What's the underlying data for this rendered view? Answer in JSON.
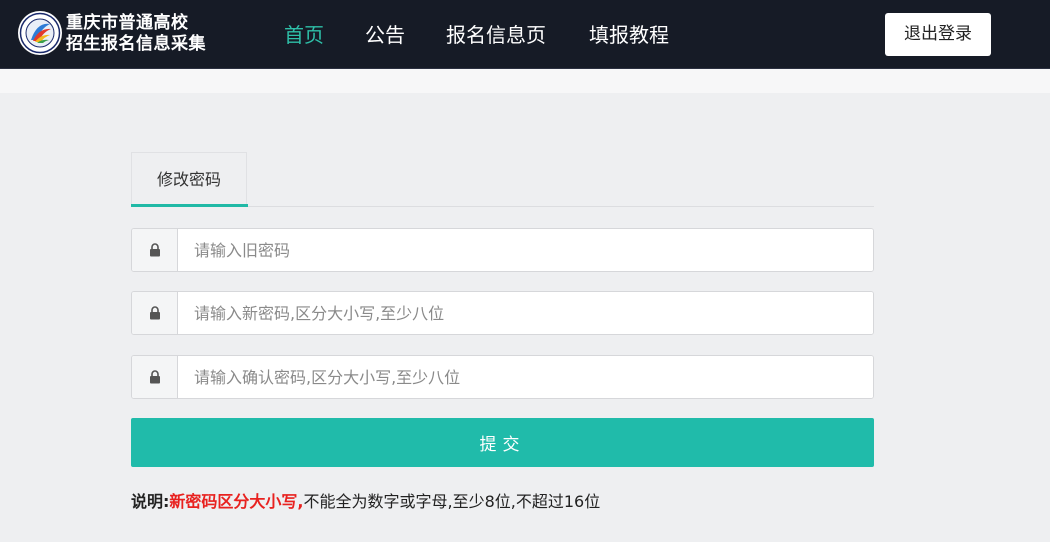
{
  "header": {
    "brand_line1": "重庆市普通高校",
    "brand_line2": "招生报名信息采集",
    "nav": [
      {
        "label": "首页",
        "active": true
      },
      {
        "label": "公告"
      },
      {
        "label": "报名信息页"
      },
      {
        "label": "填报教程"
      }
    ],
    "logout_label": "退出登录"
  },
  "form": {
    "tab_label": "修改密码",
    "old_password_placeholder": "请输入旧密码",
    "new_password_placeholder": "请输入新密码,区分大小写,至少八位",
    "confirm_password_placeholder": "请输入确认密码,区分大小写,至少八位",
    "field_icon": "lock-icon",
    "submit_label": "提交"
  },
  "note": {
    "label": "说明:",
    "highlight": "新密码区分大小写,",
    "text": "不能全为数字或字母,至少8位,不超过16位"
  },
  "colors": {
    "header_bg": "#161b26",
    "accent": "#20bbaa",
    "active_nav": "#2ebfa8",
    "warning": "#e8211f"
  }
}
